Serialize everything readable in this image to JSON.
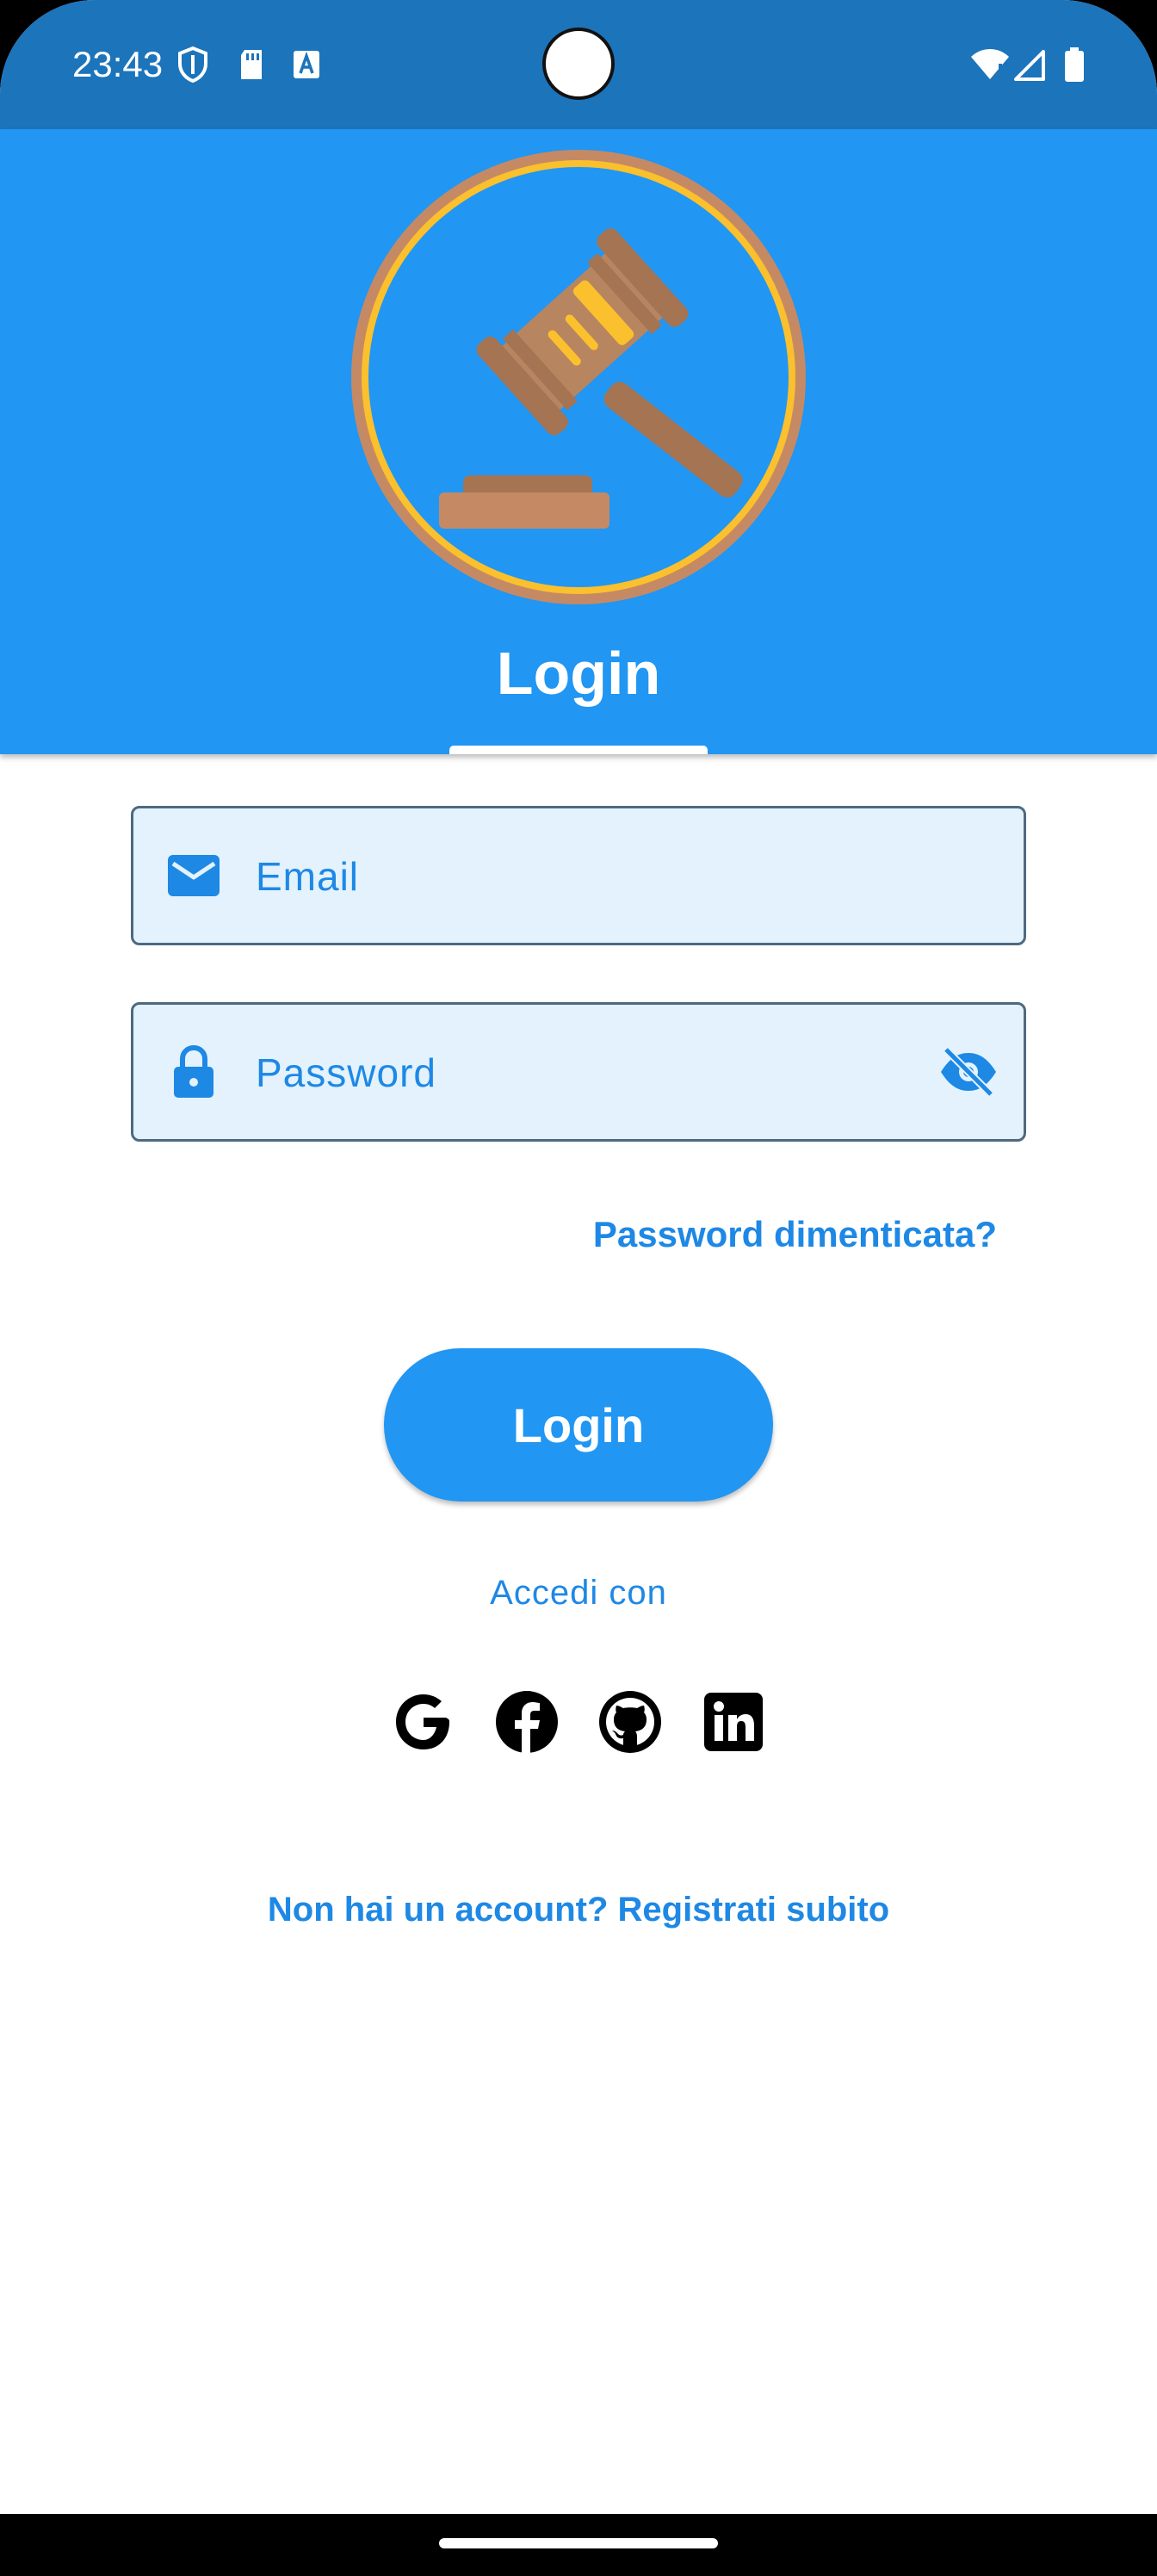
{
  "status_bar": {
    "time": "23:43",
    "icons": [
      "shield-icon",
      "sd-card-icon",
      "font-a-icon",
      "wifi-icon",
      "signal-icon",
      "battery-icon"
    ]
  },
  "header": {
    "logo": "gavel-logo",
    "title": "Login",
    "active_tab": "Login"
  },
  "form": {
    "email": {
      "placeholder": "Email",
      "value": "",
      "icon": "mail-icon"
    },
    "password": {
      "placeholder": "Password",
      "value": "",
      "icon": "lock-icon",
      "toggle_icon": "eye-off-icon"
    },
    "forgot_password": "Password dimenticata?",
    "login_button": "Login"
  },
  "social": {
    "label": "Accedi con",
    "providers": [
      "google-icon",
      "facebook-icon",
      "github-icon",
      "linkedin-icon"
    ]
  },
  "register_link": "Non hai un account? Registrati subito",
  "colors": {
    "primary": "#2196f3",
    "status_bar": "#1c74bb",
    "field_background": "#e3f2fd",
    "link": "#1e88e5"
  }
}
